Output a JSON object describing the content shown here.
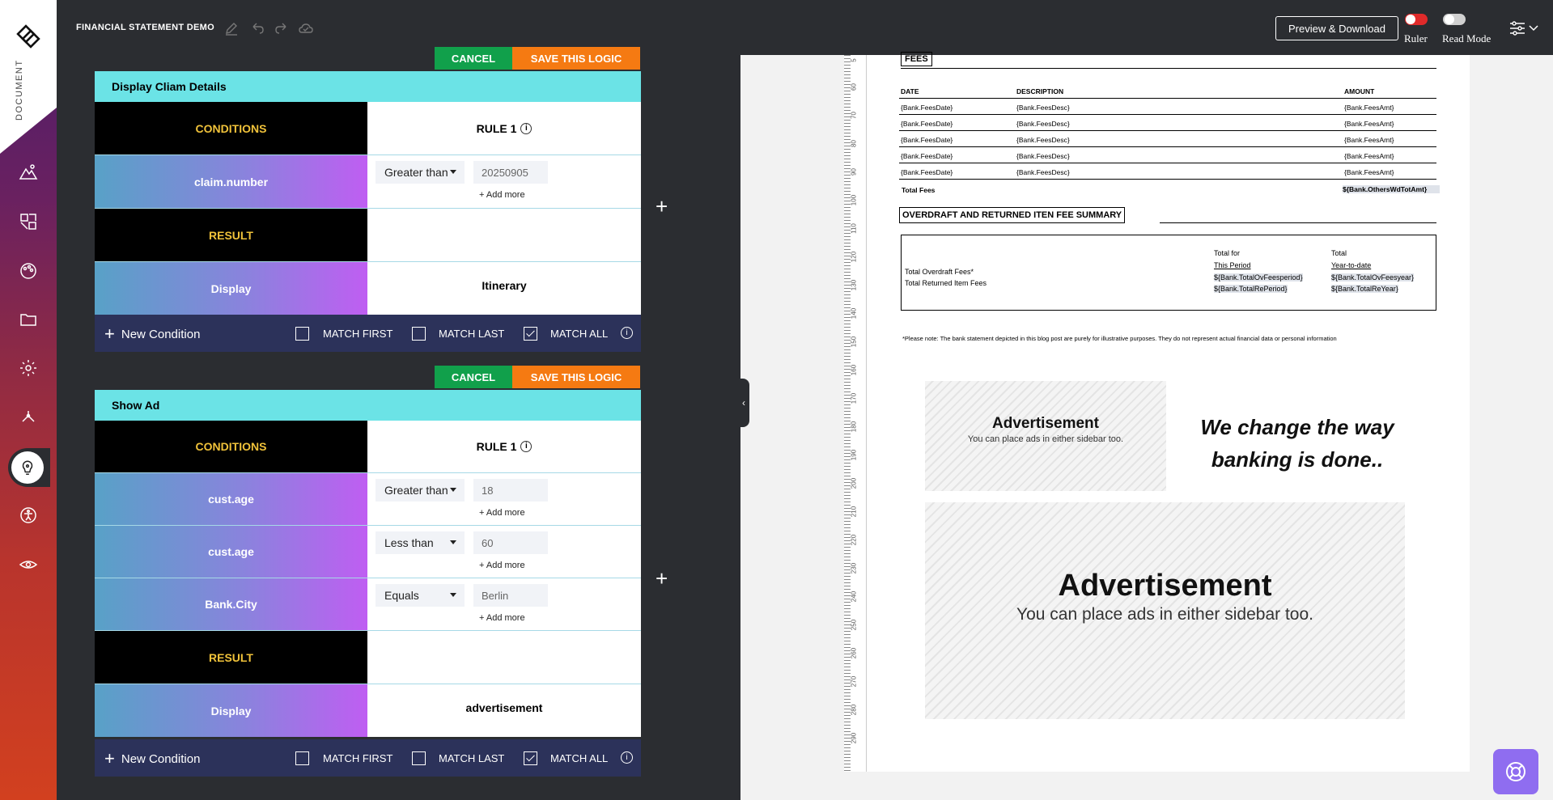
{
  "sidebar": {
    "doc_label": "DOCUMENT",
    "icons": [
      "mountain-icon",
      "shapes-icon",
      "palette-icon",
      "folder-icon",
      "gear-icon",
      "network-icon",
      "lightbulb-icon",
      "accessibility-icon",
      "eye-icon"
    ]
  },
  "topbar": {
    "title": "FINANCIAL STATEMENT DEMO",
    "preview_label": "Preview & Download",
    "ruler_label": "Ruler",
    "ruler_on": true,
    "readmode_label": "Read Mode",
    "readmode_on": false
  },
  "colors": {
    "cancel": "#11a04b",
    "save": "#f57a12",
    "card_header": "#6be3e6",
    "condition_text": "#f0c23a",
    "footer": "#2c325a",
    "toggle_on": "#e02a2a",
    "help": "#8f6df0"
  },
  "logic1": {
    "cancel_label": "CANCEL",
    "save_label": "SAVE THIS LOGIC",
    "title": "Display Cliam Details",
    "conditions_label": "CONDITIONS",
    "rule_label": "RULE 1",
    "conditions": [
      {
        "field": "claim.number",
        "operator": "Greater than",
        "value": "20250905",
        "add_more": "+ Add more"
      }
    ],
    "result_label": "RESULT",
    "result_action": "Display",
    "result_value": "Itinerary",
    "new_condition": "New Condition",
    "match_first": "MATCH FIRST",
    "match_last": "MATCH LAST",
    "match_all": "MATCH ALL"
  },
  "logic2": {
    "cancel_label": "CANCEL",
    "save_label": "SAVE THIS LOGIC",
    "title": "Show Ad",
    "conditions_label": "CONDITIONS",
    "rule_label": "RULE 1",
    "conditions": [
      {
        "field": "cust.age",
        "operator": "Greater than",
        "value": "18",
        "add_more": "+ Add more"
      },
      {
        "field": "cust.age",
        "operator": "Less than",
        "value": "60",
        "add_more": "+ Add more"
      },
      {
        "field": "Bank.City",
        "operator": "Equals",
        "value": "Berlin",
        "add_more": "+ Add more"
      }
    ],
    "result_label": "RESULT",
    "result_action": "Display",
    "result_value": "advertisement",
    "new_condition": "New Condition",
    "match_first": "MATCH FIRST",
    "match_last": "MATCH LAST",
    "match_all": "MATCH ALL"
  },
  "preview": {
    "ruler_numbers": [
      "5",
      "60",
      "70",
      "80",
      "90",
      "100",
      "110",
      "120",
      "130",
      "140",
      "150",
      "160",
      "170",
      "180",
      "190",
      "200",
      "210",
      "220",
      "230",
      "240",
      "250",
      "260",
      "270",
      "280",
      "290"
    ],
    "fees_title": "FEES",
    "fees_headers": [
      "DATE",
      "DESCRIPTION",
      "AMOUNT"
    ],
    "fees_rows": [
      [
        "{Bank.FeesDate}",
        "{Bank.FeesDesc}",
        "{Bank.FeesAmt}"
      ],
      [
        "{Bank.FeesDate}",
        "{Bank.FeesDesc}",
        "{Bank.FeesAmt}"
      ],
      [
        "{Bank.FeesDate}",
        "{Bank.FeesDesc}",
        "{Bank.FeesAmt}"
      ],
      [
        "{Bank.FeesDate}",
        "{Bank.FeesDesc}",
        "{Bank.FeesAmt}"
      ],
      [
        "{Bank.FeesDate}",
        "{Bank.FeesDesc}",
        "{Bank.FeesAmt}"
      ]
    ],
    "total_fees_label": "Total Fees",
    "total_fees_value": "${Bank.OthersWdTotAmt}",
    "od_title": "OVERDRAFT AND RETURNED ITEN FEE SUMMARY",
    "od_row1": "Total Overdraft Fees*",
    "od_row2": "Total Returned Item Fees",
    "od_col1_a": "Total for",
    "od_col1_b": "This Period",
    "od_col1_v1": "${Bank.TotalOvFeesperiod}",
    "od_col1_v2": "${Bank.TotalRePeriod}",
    "od_col2_a": "Total",
    "od_col2_b": "Year-to-date",
    "od_col2_v1": "${Bank.TotalOvFeesyear}",
    "od_col2_v2": "${Bank.TotalReYear}",
    "note": "*Please note: The bank statement depicted in this blog post are purely for illustrative purposes. They do not represent actual financial data or personal information",
    "ad_small_title": "Advertisement",
    "ad_small_sub": "You can place ads in either sidebar too.",
    "slogan": "We change the way banking is done..",
    "ad_big_title": "Advertisement",
    "ad_big_sub": "You can place ads in either sidebar too."
  }
}
